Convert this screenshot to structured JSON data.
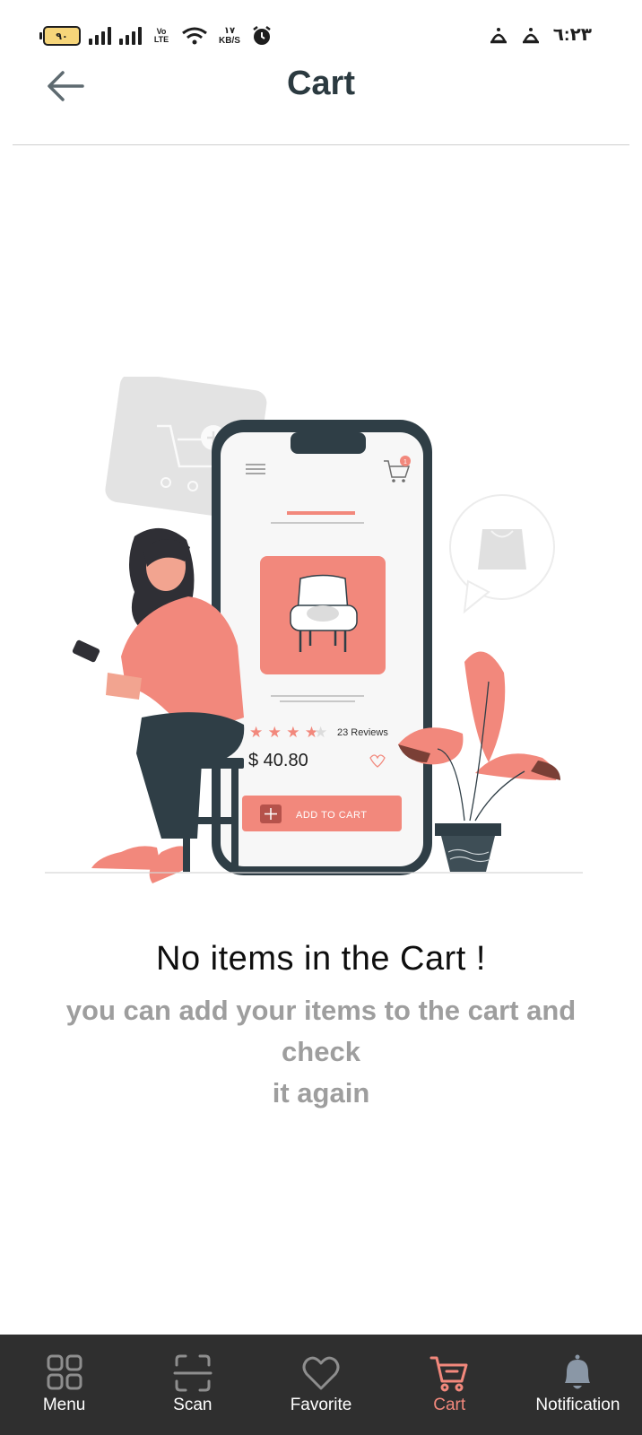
{
  "status_bar": {
    "battery_level": "٩٠",
    "volte": "Vo LTE",
    "net_speed_value": "١٧",
    "net_speed_unit": "KB/S",
    "clock": "٦:٢٣"
  },
  "header": {
    "title": "Cart"
  },
  "illustration": {
    "reviews": "23 Reviews",
    "price": "$ 40.80",
    "add_to_cart": "ADD TO CART",
    "cart_badge": "1",
    "rating_stars": 4,
    "rating_max": 5
  },
  "empty_state": {
    "title": "No items in the Cart !",
    "subtitle_line1": "you can add your items to the cart and",
    "subtitle_line2": "check",
    "subtitle_line3": "it again"
  },
  "bottom_nav": {
    "items": [
      {
        "label": "Menu",
        "icon": "grid-icon"
      },
      {
        "label": "Scan",
        "icon": "scan-icon"
      },
      {
        "label": "Favorite",
        "icon": "heart-icon"
      },
      {
        "label": "Cart",
        "icon": "cart-icon",
        "active": true
      },
      {
        "label": "Notification",
        "icon": "bell-icon"
      }
    ],
    "active_color": "#f2887c",
    "background": "#2f2f2f"
  }
}
